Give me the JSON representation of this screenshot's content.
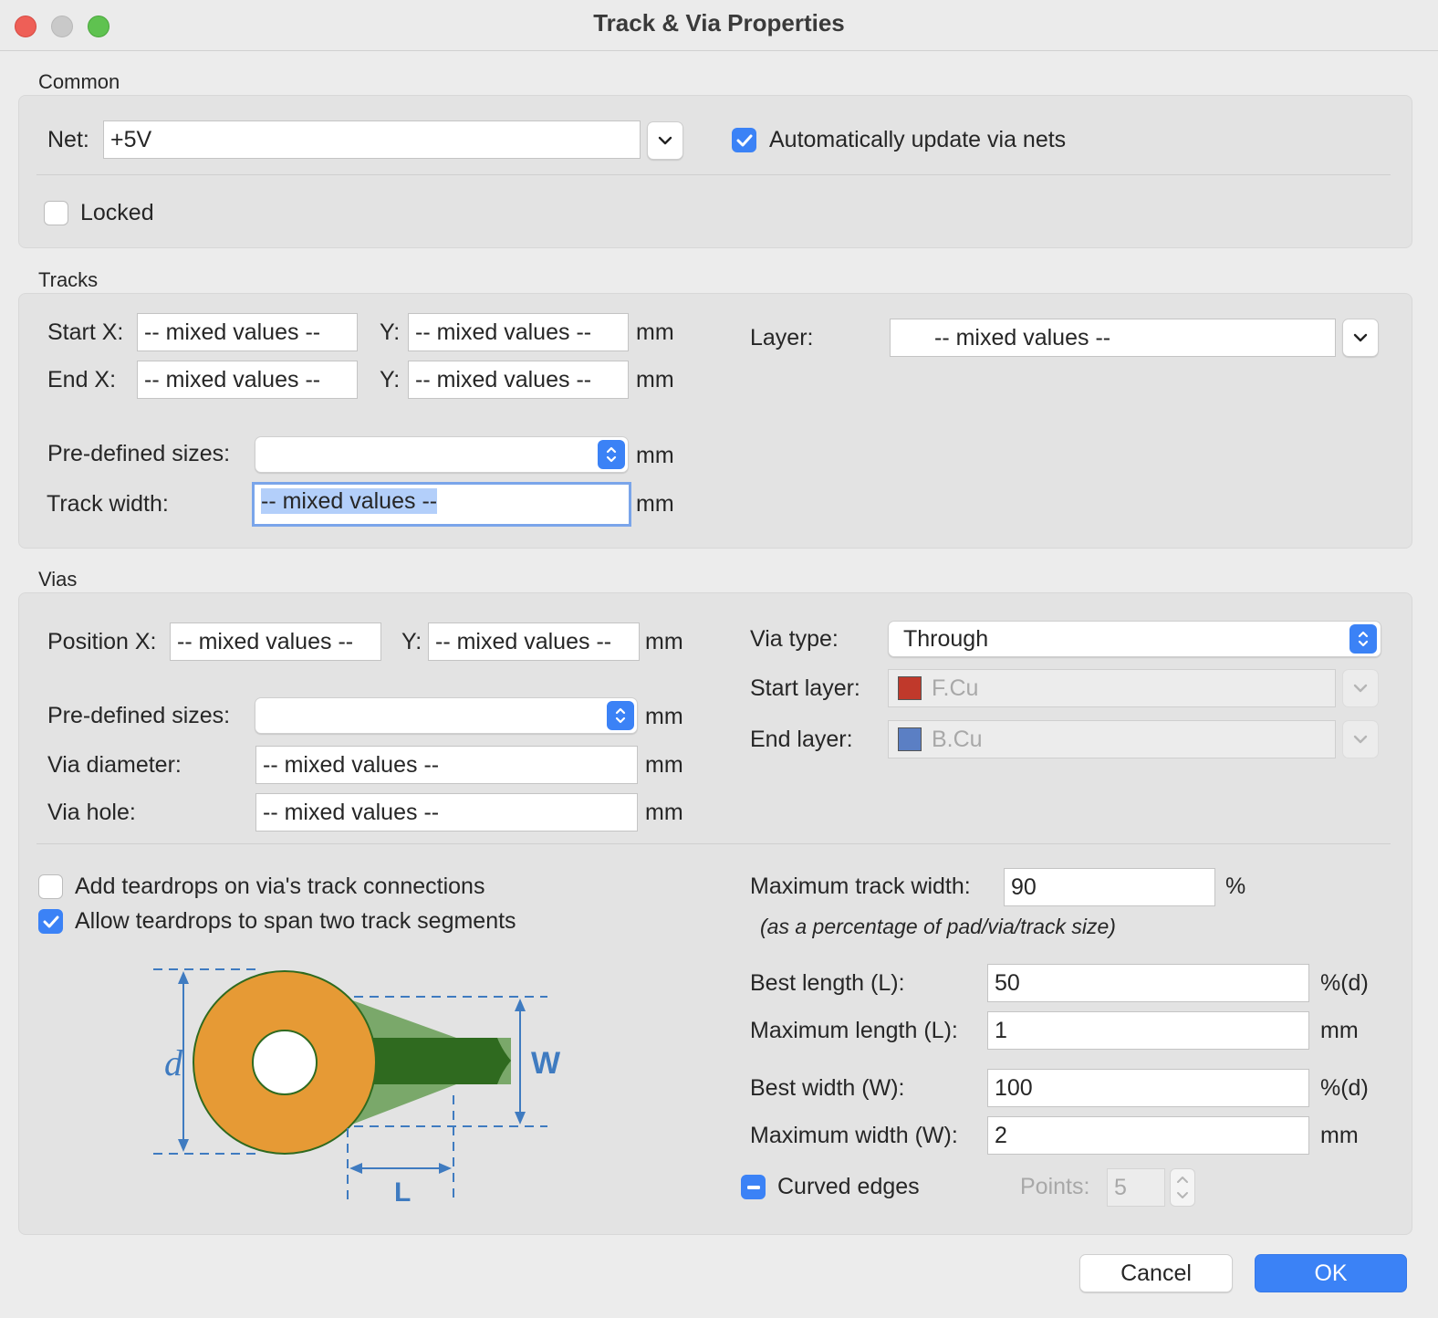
{
  "window": {
    "title": "Track & Via Properties"
  },
  "common": {
    "section": "Common",
    "net_label": "Net:",
    "net_value": "+5V",
    "auto_update_label": "Automatically update via nets",
    "auto_update_checked": true,
    "locked_label": "Locked",
    "locked_checked": false
  },
  "tracks": {
    "section": "Tracks",
    "start_x_label": "Start X:",
    "start_x": "-- mixed values --",
    "start_y_label": "Y:",
    "start_y": "-- mixed values --",
    "end_x_label": "End X:",
    "end_x": "-- mixed values --",
    "end_y_label": "Y:",
    "end_y": "-- mixed values --",
    "unit": "mm",
    "layer_label": "Layer:",
    "layer_value": "-- mixed values --",
    "predefined_label": "Pre-defined sizes:",
    "predefined_value": "",
    "width_label": "Track width:",
    "width_value": "-- mixed values --"
  },
  "vias": {
    "section": "Vias",
    "pos_x_label": "Position X:",
    "pos_x": "-- mixed values --",
    "pos_y_label": "Y:",
    "pos_y": "-- mixed values --",
    "unit": "mm",
    "predefined_label": "Pre-defined sizes:",
    "predefined_value": "",
    "diameter_label": "Via diameter:",
    "diameter_value": "-- mixed values --",
    "hole_label": "Via hole:",
    "hole_value": "-- mixed values --",
    "type_label": "Via type:",
    "type_value": "Through",
    "start_layer_label": "Start layer:",
    "start_layer_value": "F.Cu",
    "start_layer_color": "#c0392b",
    "end_layer_label": "End layer:",
    "end_layer_value": "B.Cu",
    "end_layer_color": "#5b7fc4"
  },
  "teardrops": {
    "add_label": "Add teardrops on via's track connections",
    "add_checked": false,
    "span_label": "Allow teardrops to span two track segments",
    "span_checked": true,
    "max_track_width_label": "Maximum track width:",
    "max_track_width_value": "90",
    "percent": "%",
    "note": "(as a percentage of pad/via/track size)",
    "best_length_label": "Best length (L):",
    "best_length_value": "50",
    "best_length_unit": "%(d)",
    "max_length_label": "Maximum length (L):",
    "max_length_value": "1",
    "max_length_unit": "mm",
    "best_width_label": "Best width (W):",
    "best_width_value": "100",
    "best_width_unit": "%(d)",
    "max_width_label": "Maximum width (W):",
    "max_width_value": "2",
    "max_width_unit": "mm",
    "curved_label": "Curved edges",
    "curved_state": "mixed",
    "points_label": "Points:",
    "points_value": "5",
    "diagram": {
      "d_label": "d",
      "w_label": "W",
      "l_label": "L",
      "pad_color": "#e69a35",
      "track_color": "#2f6a1f",
      "teardrop_color": "#7aa86a",
      "dim_color": "#3f7bc0"
    }
  },
  "buttons": {
    "cancel": "Cancel",
    "ok": "OK"
  }
}
